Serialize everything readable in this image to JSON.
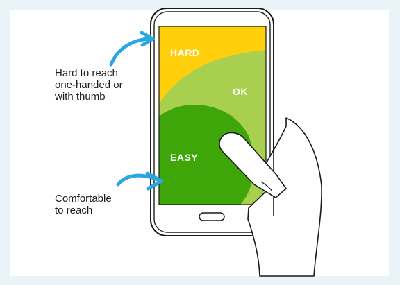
{
  "zones": {
    "hard": "HARD",
    "ok": "OK",
    "easy": "EASY"
  },
  "callouts": {
    "hard": [
      "Hard to reach",
      "one-handed or",
      "with thumb"
    ],
    "comfortable": [
      "Comfortable",
      "to reach"
    ]
  },
  "colors": {
    "background": "#eaf3f8",
    "hard_zone": "#ffcf0b",
    "ok_zone": "#a8d04e",
    "easy_zone": "#3fa609",
    "arrow": "#2aa7e0",
    "outline": "#1a1a1a"
  },
  "icons": {
    "phone": "smartphone",
    "hand": "hand-thumb",
    "arrows": "curved-arrow-right"
  }
}
